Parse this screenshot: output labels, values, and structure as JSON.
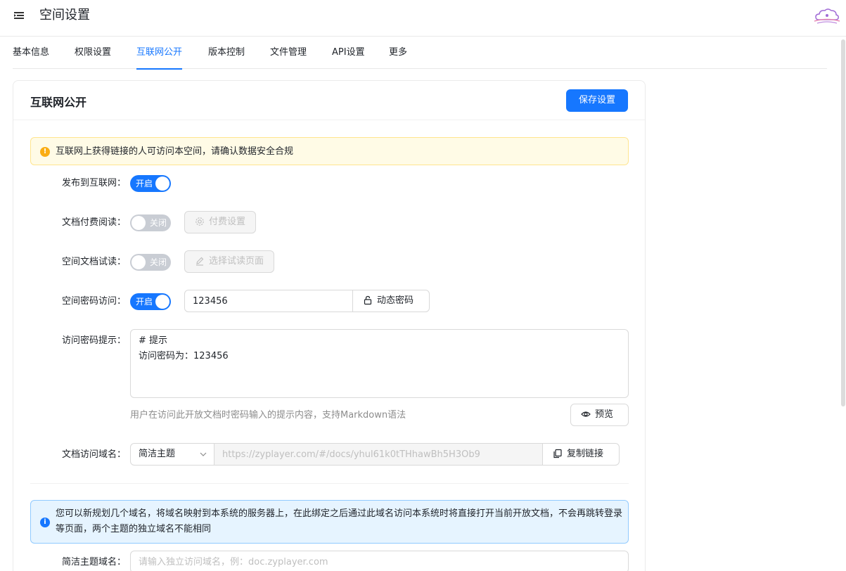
{
  "header": {
    "title": "空间设置"
  },
  "tabs": [
    {
      "label": "基本信息"
    },
    {
      "label": "权限设置"
    },
    {
      "label": "互联网公开"
    },
    {
      "label": "版本控制"
    },
    {
      "label": "文件管理"
    },
    {
      "label": "API设置"
    },
    {
      "label": "更多"
    }
  ],
  "active_tab": "互联网公开",
  "card": {
    "title": "互联网公开",
    "save_label": "保存设置"
  },
  "warning_alert": "互联网上获得链接的人可访问本空间，请确认数据安全合规",
  "publish": {
    "label": "发布到互联网：",
    "switch_text": "开启",
    "enabled": true
  },
  "paid_read": {
    "label": "文档付费阅读：",
    "switch_text": "关闭",
    "enabled": false,
    "button_label": "付费设置",
    "button_icon": "gear-icon"
  },
  "trial_read": {
    "label": "空间文档试读：",
    "switch_text": "关闭",
    "enabled": false,
    "button_label": "选择试读页面",
    "button_icon": "edit-icon"
  },
  "password_access": {
    "label": "空间密码访问：",
    "switch_text": "开启",
    "enabled": true,
    "password_value": "123456",
    "dynamic_button_label": "动态密码",
    "dynamic_button_icon": "lock-icon"
  },
  "password_hint": {
    "label": "访问密码提示：",
    "value": "# 提示\n访问密码为：123456",
    "help_text": "用户在访问此开放文档时密码输入的提示内容，支持Markdown语法",
    "preview_label": "预览",
    "preview_icon": "eye-icon"
  },
  "domain": {
    "label": "文档访问域名：",
    "theme_selected": "简洁主题",
    "url": "https://zyplayer.com/#/docs/yhul61k0tTHhawBh5H3Ob9",
    "copy_label": "复制链接",
    "copy_icon": "copy-icon"
  },
  "info_alert": "您可以新规划几个域名，将域名映射到本系统的服务器上，在此绑定之后通过此域名访问本系统时将直接打开当前开放文档，不会再跳转登录等页面，两个主题的独立域名不能相同",
  "simple_domain": {
    "label": "简洁主题域名：",
    "placeholder": "请输入独立访问域名，例：doc.zyplayer.com"
  },
  "colors": {
    "primary": "#1677ff",
    "warning_bg": "#fffbe6",
    "info_bg": "#e6f4ff",
    "switch_off": "#c9cdd4"
  }
}
